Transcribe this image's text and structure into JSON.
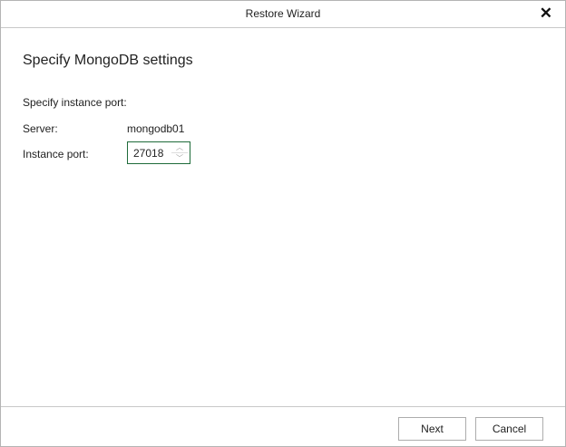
{
  "window": {
    "title": "Restore Wizard",
    "close_icon": "close-icon"
  },
  "page": {
    "heading": "Specify MongoDB settings",
    "instruction": "Specify instance port:"
  },
  "server": {
    "label": "Server:",
    "value": "mongodb01"
  },
  "port": {
    "label": "Instance port:",
    "value": "27018"
  },
  "buttons": {
    "next": "Next",
    "cancel": "Cancel"
  },
  "colors": {
    "focus_border": "#1e6b3a"
  }
}
